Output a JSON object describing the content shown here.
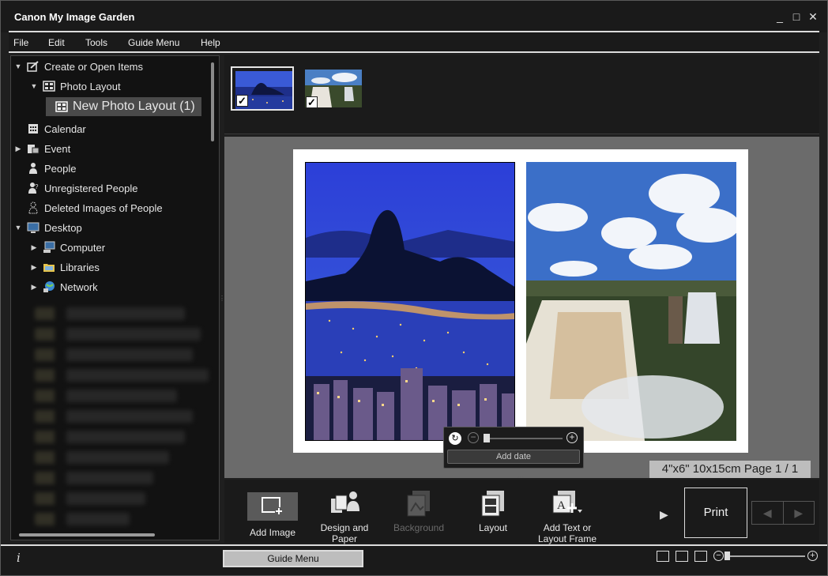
{
  "window": {
    "title": "Canon My Image Garden",
    "controls": {
      "minimize": "_",
      "maximize": "□",
      "close": "✕"
    }
  },
  "menu": [
    "File",
    "Edit",
    "Tools",
    "Guide Menu",
    "Help"
  ],
  "sidebar": {
    "items": [
      {
        "label": "Create or Open Items",
        "icon": "create-items-icon",
        "expand": "▼"
      },
      {
        "label": "Photo Layout",
        "icon": "photo-layout-icon",
        "expand": "▼"
      },
      {
        "label": "New Photo Layout (1)",
        "icon": "photo-layout-icon",
        "selected": true
      },
      {
        "label": "Calendar",
        "icon": "calendar-icon"
      },
      {
        "label": "Event",
        "icon": "event-icon",
        "expand": "▶"
      },
      {
        "label": "People",
        "icon": "person-icon"
      },
      {
        "label": "Unregistered People",
        "icon": "unregistered-person-icon"
      },
      {
        "label": "Deleted Images of People",
        "icon": "deleted-person-icon"
      },
      {
        "label": "Desktop",
        "icon": "desktop-icon",
        "expand": "▼"
      },
      {
        "label": "Computer",
        "icon": "computer-icon",
        "expand": "▶"
      },
      {
        "label": "Libraries",
        "icon": "libraries-icon",
        "expand": "▶"
      },
      {
        "label": "Network",
        "icon": "network-icon",
        "expand": "▶"
      }
    ]
  },
  "thumbnails": [
    {
      "name": "rio-night-thumbnail",
      "checked": "✓",
      "selected": true
    },
    {
      "name": "waterfall-thumbnail",
      "checked": "✓",
      "selected": false
    }
  ],
  "editor": {
    "add_date": "Add date",
    "page_info": "4\"x6\" 10x15cm Page 1 / 1"
  },
  "toolbar": {
    "add_image": "Add Image",
    "design_paper": "Design and Paper",
    "background": "Background",
    "layout": "Layout",
    "add_text": "Add Text or Layout Frame",
    "print": "Print"
  },
  "status": {
    "info": "i",
    "guide_menu": "Guide Menu"
  },
  "colors": {
    "window_bg": "#1f1f1f",
    "panel_bg": "#121212",
    "canvas_bg": "#6b6b6b",
    "accent_light": "#dcdcdc"
  }
}
